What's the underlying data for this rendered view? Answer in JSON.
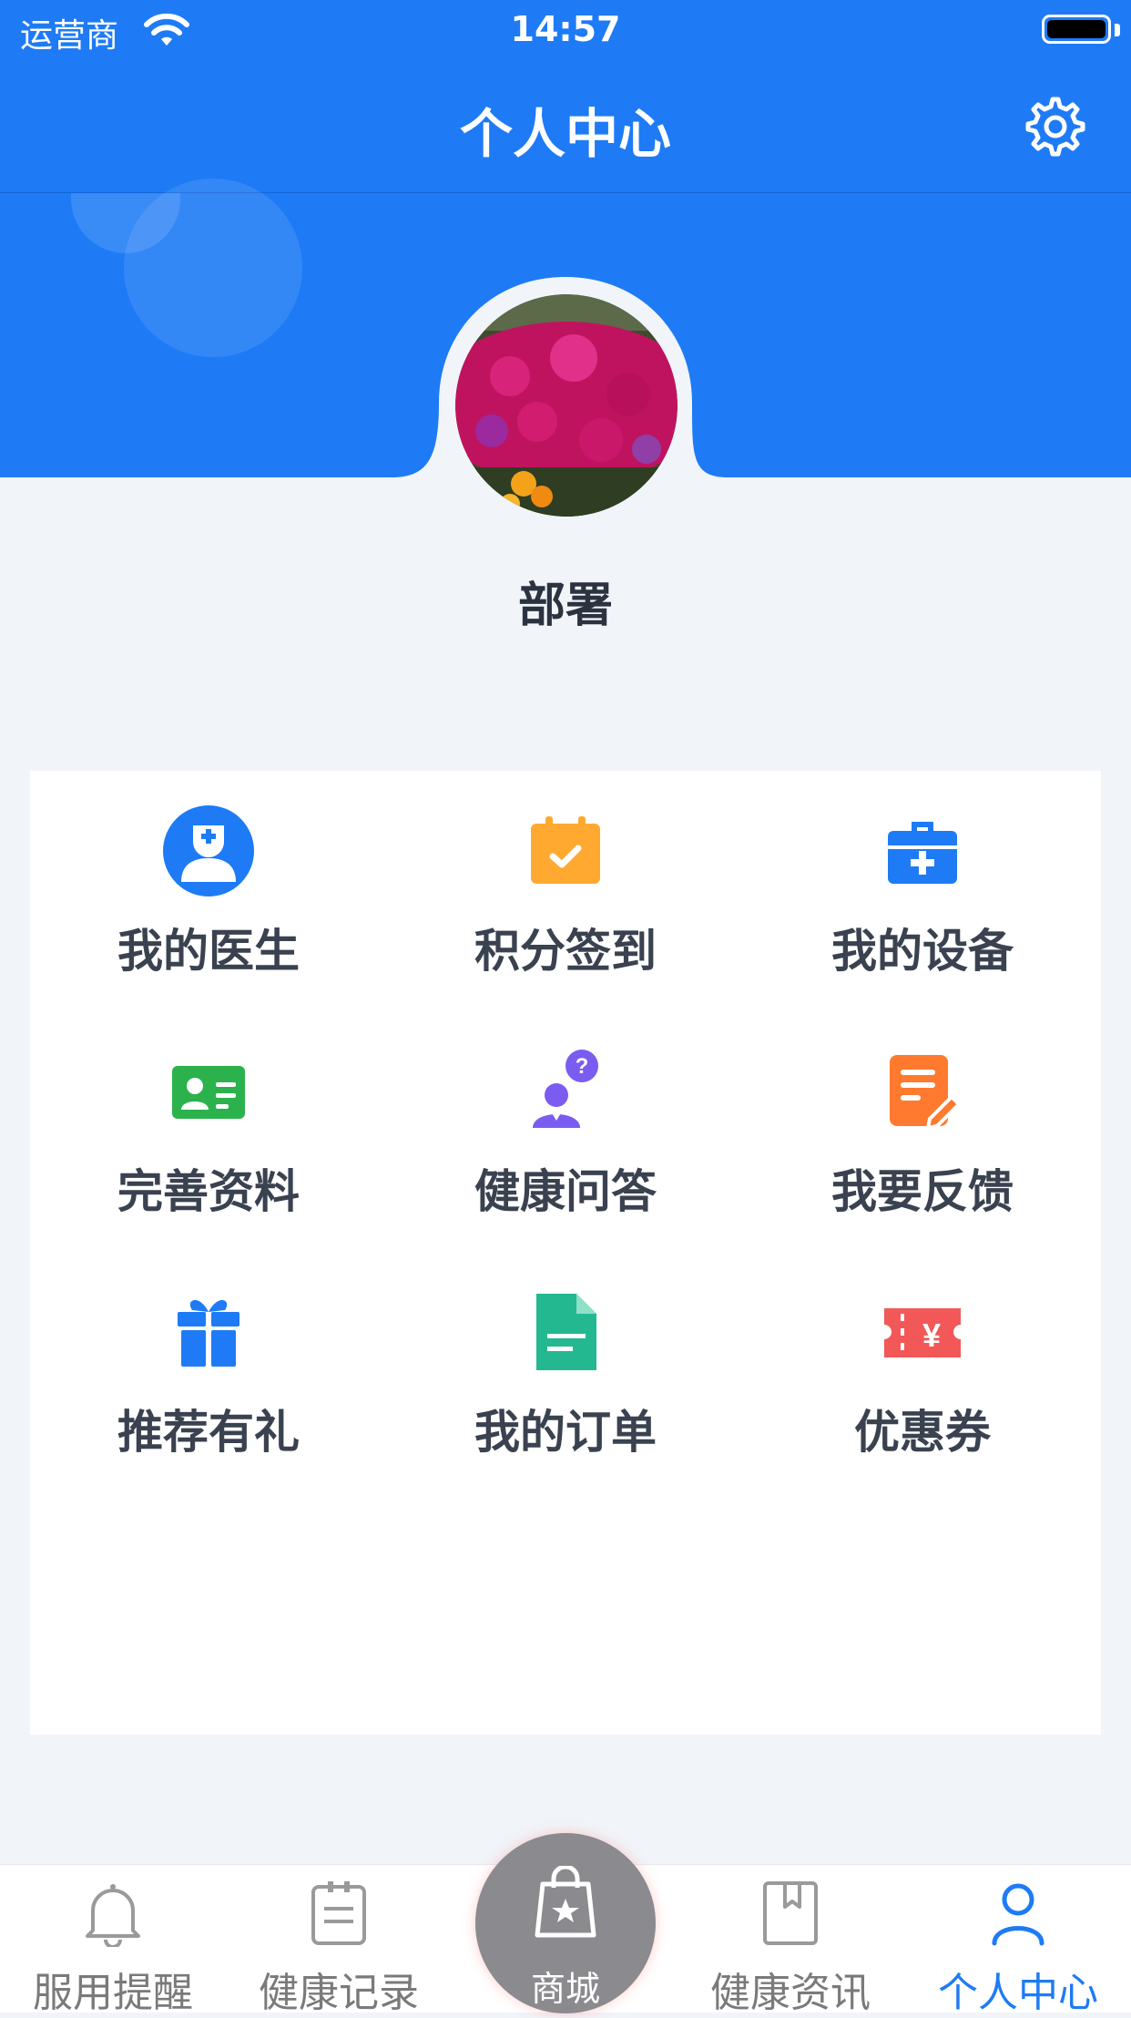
{
  "status_bar": {
    "carrier": "运营商",
    "time": "14:57"
  },
  "header": {
    "title": "个人中心"
  },
  "profile": {
    "name": "部署"
  },
  "menu": [
    {
      "label": "我的医生",
      "icon": "doctor-icon",
      "color": "#1e7bf5"
    },
    {
      "label": "积分签到",
      "icon": "calendar-check-icon",
      "color": "#ffa931"
    },
    {
      "label": "我的设备",
      "icon": "medical-kit-icon",
      "color": "#1e7bf5"
    },
    {
      "label": "完善资料",
      "icon": "id-card-icon",
      "color": "#2bb24c"
    },
    {
      "label": "健康问答",
      "icon": "question-user-icon",
      "color": "#7b5cf0"
    },
    {
      "label": "我要反馈",
      "icon": "feedback-edit-icon",
      "color": "#ff7a2e"
    },
    {
      "label": "推荐有礼",
      "icon": "gift-icon",
      "color": "#1e7bf5"
    },
    {
      "label": "我的订单",
      "icon": "order-document-icon",
      "color": "#24b891"
    },
    {
      "label": "优惠券",
      "icon": "coupon-icon",
      "color": "#f25858"
    }
  ],
  "tabbar": {
    "tabs": [
      {
        "label": "服用提醒",
        "icon": "bell-icon"
      },
      {
        "label": "健康记录",
        "icon": "clipboard-icon"
      },
      {
        "label": "商城",
        "icon": "shopping-bag-icon"
      },
      {
        "label": "健康资讯",
        "icon": "bookmark-book-icon"
      },
      {
        "label": "个人中心",
        "icon": "user-icon"
      }
    ],
    "active_index": 4
  },
  "colors": {
    "primary": "#1e7bf5",
    "background": "#f1f4f9",
    "tab_inactive": "#7a7a7a"
  }
}
